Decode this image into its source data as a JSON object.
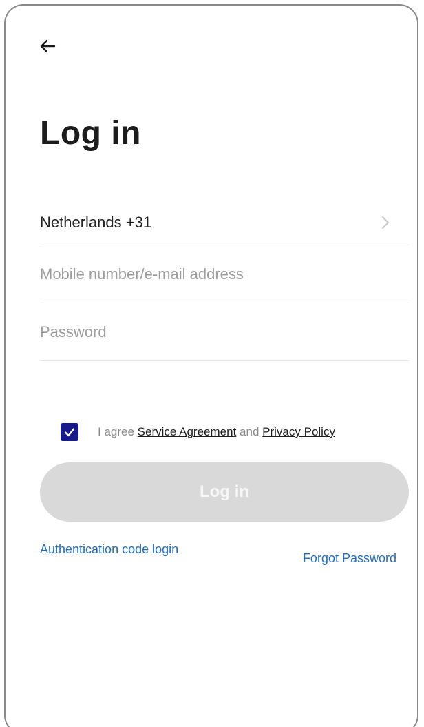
{
  "header": {
    "back_icon": "arrow-left-icon",
    "title": "Log in"
  },
  "form": {
    "country": "Netherlands +31",
    "country_chevron_icon": "chevron-right-icon",
    "account_placeholder": "Mobile number/e-mail address",
    "account_value": "",
    "password_placeholder": "Password",
    "password_value": ""
  },
  "agreement": {
    "checked": true,
    "checkbox_color": "#161a8a",
    "prefix": "I agree",
    "service_link": "Service Agreement",
    "conjunction": "and",
    "privacy_link": "Privacy Policy"
  },
  "actions": {
    "login_label": "Log in",
    "login_enabled": false,
    "auth_code_label": "Authentication code login",
    "forgot_label": "Forgot Password",
    "link_color": "#1f6fc4"
  }
}
